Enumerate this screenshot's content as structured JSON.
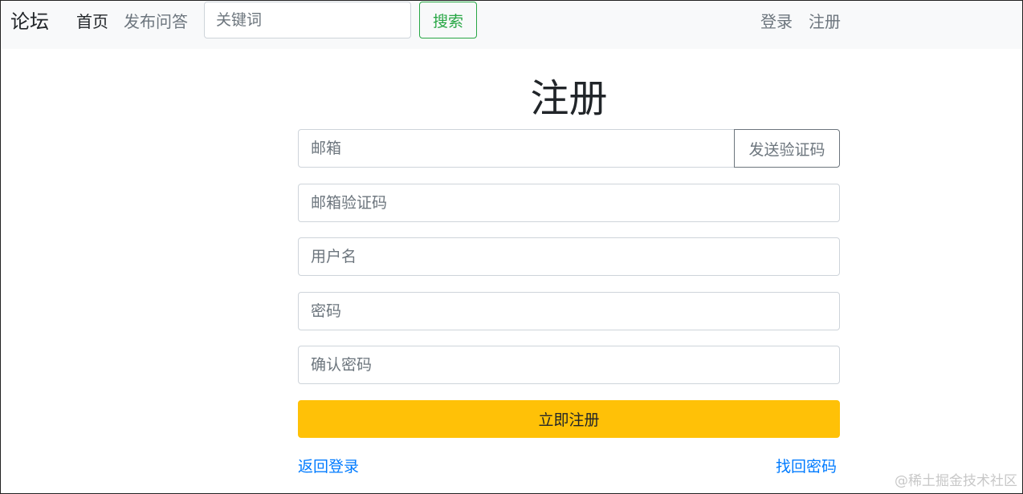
{
  "navbar": {
    "brand": "论坛",
    "links": [
      {
        "label": "首页"
      },
      {
        "label": "发布问答"
      }
    ],
    "search_placeholder": "关键词",
    "search_button": "搜索",
    "login": "登录",
    "register": "注册"
  },
  "form": {
    "title": "注册",
    "email_placeholder": "邮箱",
    "send_code_button": "发送验证码",
    "code_placeholder": "邮箱验证码",
    "username_placeholder": "用户名",
    "password_placeholder": "密码",
    "confirm_password_placeholder": "确认密码",
    "submit_button": "立即注册",
    "back_to_login": "返回登录",
    "find_password": "找回密码"
  },
  "watermark": "@稀土掘金技术社区",
  "colors": {
    "navbar_bg": "#f8f9fa",
    "success": "#28a745",
    "warning": "#ffc107",
    "link": "#007bff",
    "secondary": "#6c757d"
  }
}
